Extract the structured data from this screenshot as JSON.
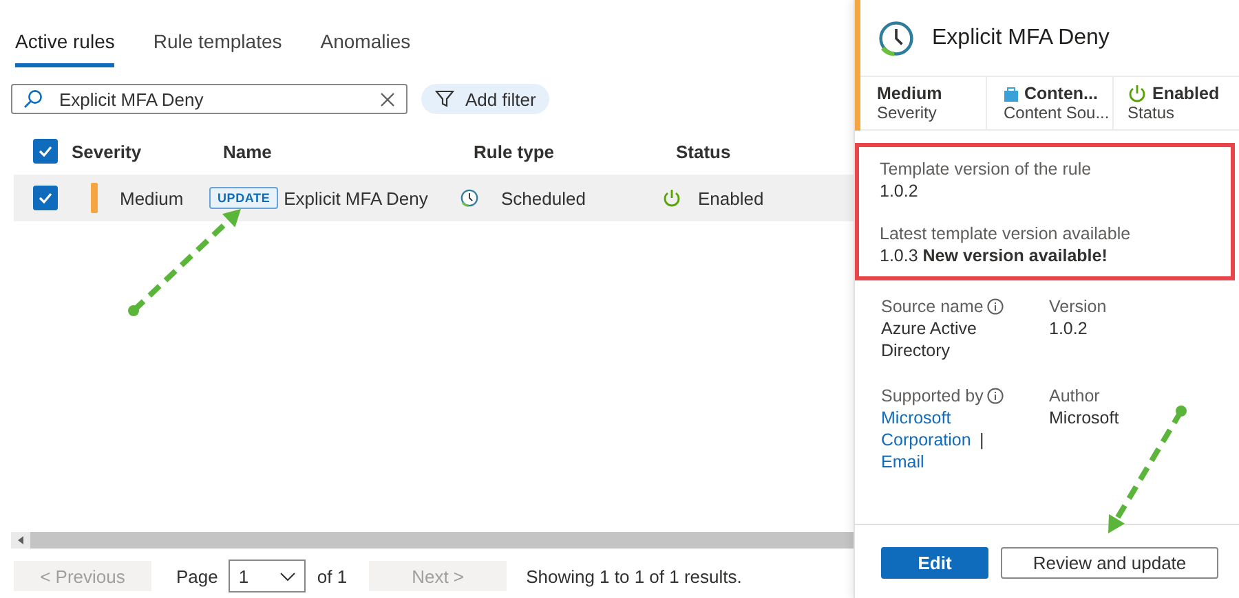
{
  "tabs": [
    {
      "label": "Active rules",
      "selected": true
    },
    {
      "label": "Rule templates",
      "selected": false
    },
    {
      "label": "Anomalies",
      "selected": false
    }
  ],
  "search": {
    "value": "Explicit MFA Deny"
  },
  "filter_button": "Add filter",
  "table": {
    "select_all_checked": true,
    "columns": [
      "Severity",
      "Name",
      "Rule type",
      "Status"
    ],
    "rows": [
      {
        "checked": true,
        "selected": true,
        "severity": "Medium",
        "badge": "UPDATE",
        "name": "Explicit MFA Deny",
        "rule_type": "Scheduled",
        "status": "Enabled"
      }
    ]
  },
  "pagination": {
    "previous": "< Previous",
    "page_label": "Page",
    "page": "1",
    "of": "of 1",
    "next": "Next >",
    "summary": "Showing 1 to 1 of 1 results."
  },
  "details": {
    "title": "Explicit MFA Deny",
    "tiles": [
      {
        "kind": "plain",
        "value": "Medium",
        "label": "Severity"
      },
      {
        "kind": "content",
        "value": "Conten...",
        "label": "Content Sou..."
      },
      {
        "kind": "status",
        "value": "Enabled",
        "label": "Status"
      }
    ],
    "template_version_label": "Template version of the rule",
    "template_version": "1.0.2",
    "latest_version_label": "Latest template version available",
    "latest_version": "1.0.3 **New version available!**",
    "fields": [
      {
        "label": "Source name",
        "info": true,
        "lines": [
          {
            "text": "Azure Active Directory",
            "link": false
          }
        ]
      },
      {
        "label": "Version",
        "info": false,
        "lines": [
          {
            "text": "1.0.2",
            "link": false
          }
        ]
      },
      {
        "label": "Supported by",
        "info": true,
        "lines": [
          {
            "text": "Microsoft Corporation",
            "link": true
          },
          {
            "text": "|",
            "link": false
          },
          {
            "text": "Email",
            "link": true
          }
        ]
      },
      {
        "label": "Author",
        "info": false,
        "lines": [
          {
            "text": "Microsoft",
            "link": false
          }
        ]
      }
    ],
    "buttons": [
      {
        "label": "Edit",
        "primary": true
      },
      {
        "label": "Review and update",
        "primary": false
      }
    ]
  }
}
